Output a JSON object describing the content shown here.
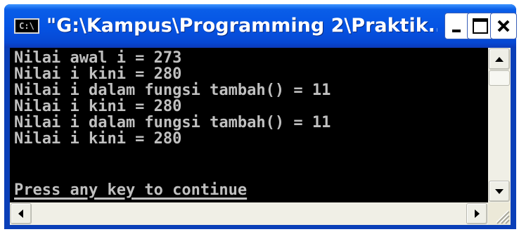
{
  "window": {
    "title": "\"G:\\Kampus\\Programming 2\\Praktik...",
    "icon_label": "C:\\",
    "icons": {
      "app": "console-icon",
      "minimize": "minimize-icon",
      "maximize": "maximize-icon",
      "close": "close-icon"
    }
  },
  "console": {
    "lines": [
      "Nilai awal i = 273",
      "Nilai i kini = 280",
      "Nilai i dalam fungsi tambah() = 11",
      "Nilai i kini = 280",
      "Nilai i dalam fungsi tambah() = 11",
      "Nilai i kini = 280",
      "",
      "Press any key to continue"
    ],
    "background_color": "#000000",
    "text_color": "#c0c0c0"
  },
  "scrollbars": {
    "vertical": {
      "up_icon": "arrow-up-icon",
      "down_icon": "arrow-down-icon"
    },
    "horizontal": {
      "left_icon": "arrow-left-icon",
      "right_icon": "arrow-right-icon"
    }
  },
  "colors": {
    "titlebar": "#0554e4",
    "close_button": "#e0401c"
  }
}
